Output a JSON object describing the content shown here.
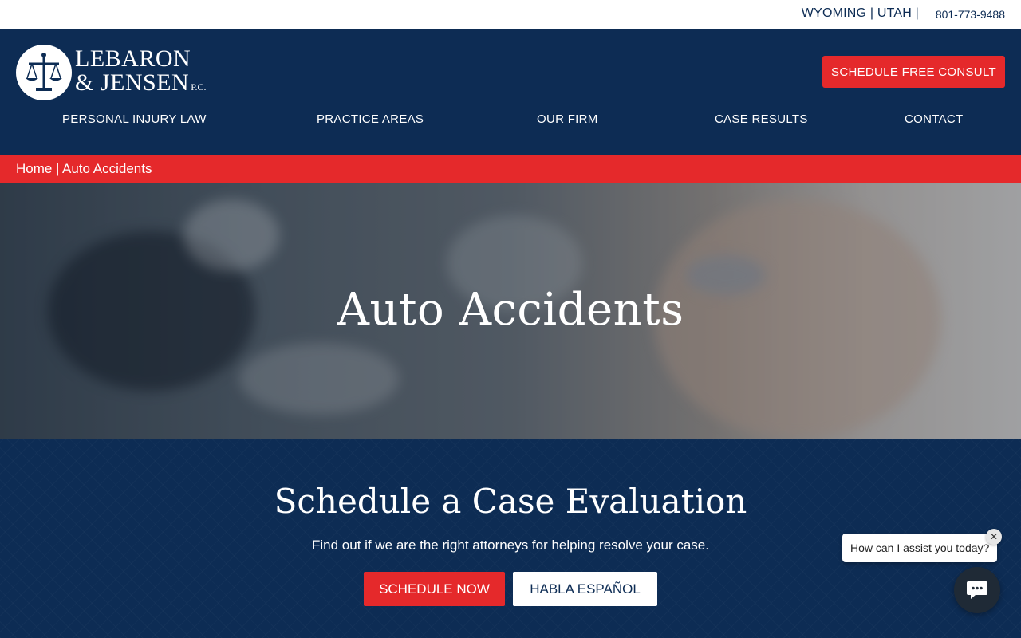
{
  "topbar": {
    "states": "WYOMING | UTAH |",
    "phone": "801-773-9488"
  },
  "header": {
    "logo": {
      "line1": "LEBARON",
      "line2": "& JENSEN",
      "suffix": "P.C."
    },
    "consult_button": "SCHEDULE FREE CONSULT",
    "nav": [
      {
        "label": "PERSONAL INJURY LAW"
      },
      {
        "label": "PRACTICE AREAS"
      },
      {
        "label": "OUR FIRM"
      },
      {
        "label": "CASE RESULTS"
      },
      {
        "label": "CONTACT"
      }
    ]
  },
  "breadcrumb": {
    "home": "Home",
    "separator": "|",
    "current": "Auto Accidents"
  },
  "hero": {
    "title": "Auto Accidents"
  },
  "evaluation": {
    "title": "Schedule a Case Evaluation",
    "subtitle": "Find out if we are the right attorneys for helping resolve your case.",
    "schedule_button": "SCHEDULE NOW",
    "spanish_button": "HABLA ESPAÑOL"
  },
  "chat": {
    "prompt": "How can I assist you today?",
    "close_icon": "close-icon",
    "launcher_icon": "chat-icon"
  },
  "colors": {
    "navy": "#0d2c54",
    "red": "#e5292b",
    "white": "#ffffff"
  }
}
